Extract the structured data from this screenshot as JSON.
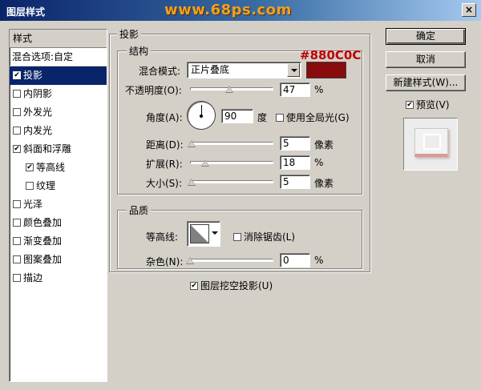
{
  "window": {
    "title": "图层样式",
    "watermark": "www.68ps.com",
    "close": "×"
  },
  "left": {
    "header": "样式",
    "blend_options": "混合选项:自定",
    "items": [
      {
        "label": "投影",
        "checked": true,
        "selected": true,
        "indent": false
      },
      {
        "label": "内阴影",
        "checked": false,
        "selected": false,
        "indent": false
      },
      {
        "label": "外发光",
        "checked": false,
        "selected": false,
        "indent": false
      },
      {
        "label": "内发光",
        "checked": false,
        "selected": false,
        "indent": false
      },
      {
        "label": "斜面和浮雕",
        "checked": true,
        "selected": false,
        "indent": false
      },
      {
        "label": "等高线",
        "checked": true,
        "selected": false,
        "indent": true
      },
      {
        "label": "纹理",
        "checked": false,
        "selected": false,
        "indent": true
      },
      {
        "label": "光泽",
        "checked": false,
        "selected": false,
        "indent": false
      },
      {
        "label": "颜色叠加",
        "checked": false,
        "selected": false,
        "indent": false
      },
      {
        "label": "渐变叠加",
        "checked": false,
        "selected": false,
        "indent": false
      },
      {
        "label": "图案叠加",
        "checked": false,
        "selected": false,
        "indent": false
      },
      {
        "label": "描边",
        "checked": false,
        "selected": false,
        "indent": false
      }
    ]
  },
  "buttons": {
    "ok": "确定",
    "cancel": "取消",
    "new_style": "新建样式(W)...",
    "preview": "预览(V)"
  },
  "shadow": {
    "group_title": "投影",
    "structure_title": "结构",
    "blend_mode_label": "混合模式:",
    "blend_mode_value": "正片叠底",
    "color": "#880c0c",
    "color_hex_label": "#880C0C",
    "opacity_label": "不透明度(O):",
    "opacity_value": "47",
    "opacity_unit": "%",
    "opacity_fraction": 0.47,
    "angle_label": "角度(A):",
    "angle_value": "90",
    "angle_unit": "度",
    "global_light_label": "使用全局光(G)",
    "distance_label": "距离(D):",
    "distance_value": "5",
    "distance_unit": "像素",
    "distance_fraction": 0.02,
    "spread_label": "扩展(R):",
    "spread_value": "18",
    "spread_unit": "%",
    "spread_fraction": 0.18,
    "size_label": "大小(S):",
    "size_value": "5",
    "size_unit": "像素",
    "size_fraction": 0.02
  },
  "quality": {
    "title": "品质",
    "contour_label": "等高线:",
    "anti_alias_label": "消除锯齿(L)",
    "noise_label": "杂色(N):",
    "noise_value": "0",
    "noise_unit": "%",
    "noise_fraction": 0
  },
  "knockout": {
    "label": "图层挖空投影(U)"
  }
}
